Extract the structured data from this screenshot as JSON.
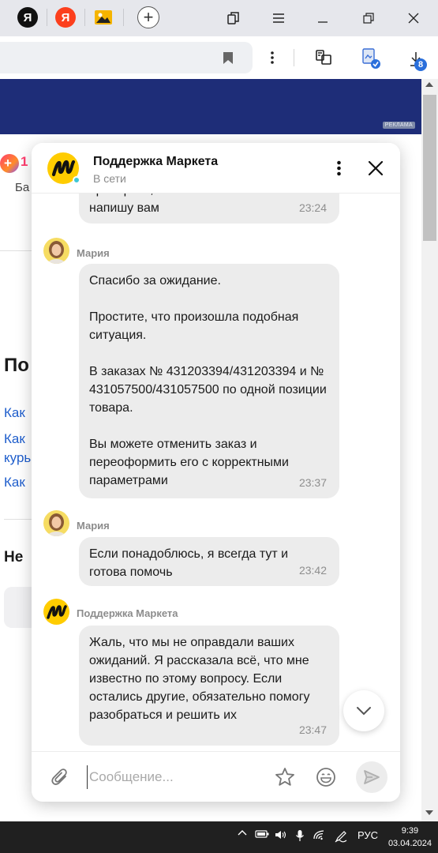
{
  "browser": {
    "tabs": [
      {
        "icon": "yandex-black-icon",
        "glyph": "Я",
        "color": "#111111"
      },
      {
        "icon": "yandex-red-icon",
        "glyph": "Я",
        "color": "#f33"
      },
      {
        "icon": "images-icon",
        "color": "#f5b400"
      }
    ],
    "downloads_count": "8"
  },
  "page": {
    "ad_label": "РЕКЛАМА",
    "frag_plus": "1",
    "frag_balance": "Ба",
    "frag_heading": "По",
    "links": [
      "Как",
      "Как",
      "курь",
      "Как"
    ],
    "frag_no": "Не"
  },
  "chat": {
    "title": "Поддержка Маркета",
    "status": "В сети",
    "messages": [
      {
        "text": "проверить, а затем я обязательно\nнапишу вам",
        "time": "23:24"
      },
      {
        "sender": "Мария",
        "text": "Спасибо за ожидание.\n\nПростите, что произошла подобная ситуация.\n\nВ заказах № 431203394/431203394 и № 431057500/431057500 по одной позиции товара.\n\nВы можете отменить заказ и переоформить его с корректными параметрами",
        "time": "23:37"
      },
      {
        "sender": "Мария",
        "text": "Если понадоблюсь, я всегда тут и готова помочь",
        "time": "23:42"
      },
      {
        "sender": "Поддержка Маркета",
        "text": "Жаль, что мы не оправдали ваших ожиданий. Я рассказала всё, что мне известно по этому вопросу. Если остались другие, обязательно помогу разобраться и решить их",
        "time": "23:47"
      }
    ],
    "input_placeholder": "Сообщение..."
  },
  "taskbar": {
    "language": "РУС",
    "time": "9:39",
    "date": "03.04.2024"
  }
}
